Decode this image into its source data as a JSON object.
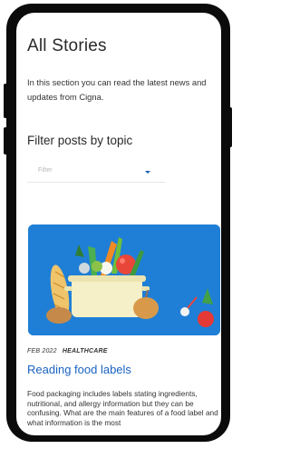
{
  "page": {
    "title": "All Stories",
    "intro": "In this section you can read the latest news and updates from Cigna."
  },
  "filter": {
    "heading": "Filter posts by topic",
    "placeholder": "Filter"
  },
  "story": {
    "date": "FEB 2022",
    "topic": "HEALTHCARE",
    "title": "Reading food labels",
    "excerpt": "Food packaging includes labels stating ingredients, nutritional, and allergy information but they can be confusing. What are the main features of a food label and what information is the most"
  },
  "colors": {
    "accent": "#1a63c2",
    "hero_background": "#1f7fd6",
    "device_frame": "#0b0b0b"
  }
}
